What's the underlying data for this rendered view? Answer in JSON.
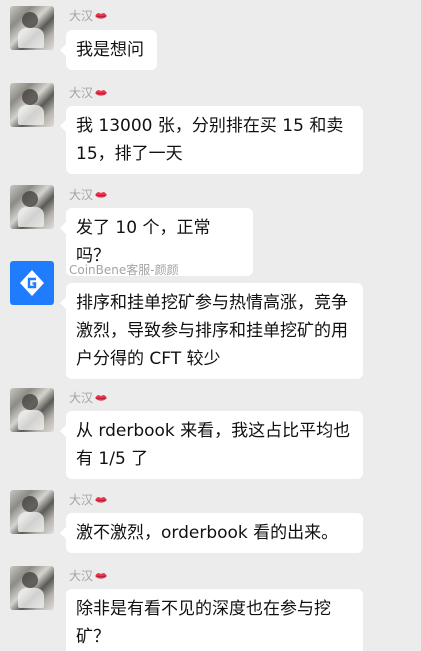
{
  "messages": [
    {
      "sender": "大汉",
      "avatar": "user-photo",
      "has_lips_icon": true,
      "text": "我是想问"
    },
    {
      "sender": "大汉",
      "avatar": "user-photo",
      "has_lips_icon": true,
      "text": "我 13000 张，分别排在买 15 和卖 15，排了一天"
    },
    {
      "sender": "大汉",
      "avatar": "user-photo",
      "has_lips_icon": true,
      "text": "发了 10 个，正常吗？"
    },
    {
      "sender": "CoinBene客服-颜颜",
      "avatar": "coinbene-logo",
      "has_lips_icon": false,
      "text": "排序和挂单挖矿参与热情高涨，竞争激烈，导致参与排序和挂单挖矿的用户分得的 CFT 较少"
    },
    {
      "sender": "大汉",
      "avatar": "user-photo",
      "has_lips_icon": true,
      "text": "从 rderbook 来看，我这占比平均也有 1/5 了"
    },
    {
      "sender": "大汉",
      "avatar": "user-photo",
      "has_lips_icon": true,
      "text": "激不激烈，orderbook 看的出来。"
    },
    {
      "sender": "大汉",
      "avatar": "user-photo",
      "has_lips_icon": true,
      "text": "除非是有看不见的深度也在参与挖矿？"
    }
  ],
  "colors": {
    "background": "#ececec",
    "bubble": "#ffffff",
    "sender_name": "#a3a3a3",
    "brand_blue": "#1f7cff",
    "lips_red": "#e8344f"
  }
}
